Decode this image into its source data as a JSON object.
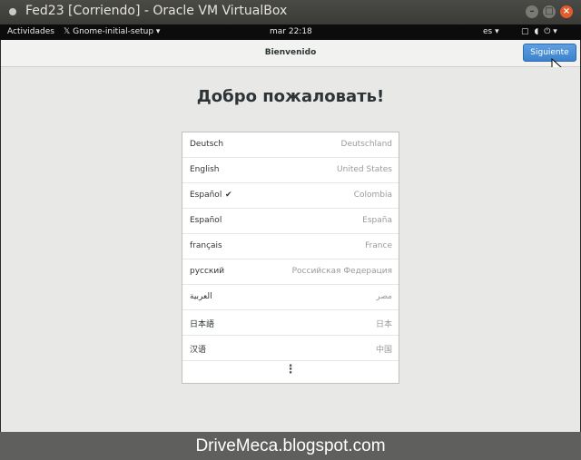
{
  "window": {
    "title": "Fed23 [Corriendo] - Oracle VM VirtualBox",
    "controls": {
      "minimize": "–",
      "maximize": "□",
      "close": "×"
    }
  },
  "topbar": {
    "activities": "Actividades",
    "app_menu": "Gnome-initial-setup ▾",
    "clock": "mar 22:18",
    "language": "es ▾",
    "icons": [
      "screen-icon",
      "volume-icon",
      "power-icon"
    ]
  },
  "header": {
    "title": "Bienvenido",
    "next_button": "Siguiente"
  },
  "main": {
    "welcome": "Добро пожаловать!",
    "languages": [
      {
        "name": "Deutsch",
        "region": "Deutschland",
        "selected": false
      },
      {
        "name": "English",
        "region": "United States",
        "selected": false
      },
      {
        "name": "Español",
        "region": "Colombia",
        "selected": true,
        "check": "✔"
      },
      {
        "name": "Español",
        "region": "España",
        "selected": false
      },
      {
        "name": "français",
        "region": "France",
        "selected": false
      },
      {
        "name": "русский",
        "region": "Российская Федерация",
        "selected": false
      },
      {
        "name": "العربية",
        "region": "مصر",
        "selected": false
      },
      {
        "name": "日本語",
        "region": "日本",
        "selected": false
      },
      {
        "name": "汉语",
        "region": "中国",
        "selected": false
      }
    ],
    "more": "⋮"
  },
  "watermark": "DriveMeca.blogspot.com",
  "colors": {
    "accent": "#4a90d9",
    "topbar": "#0c0c0c",
    "close": "#e25b2d"
  }
}
